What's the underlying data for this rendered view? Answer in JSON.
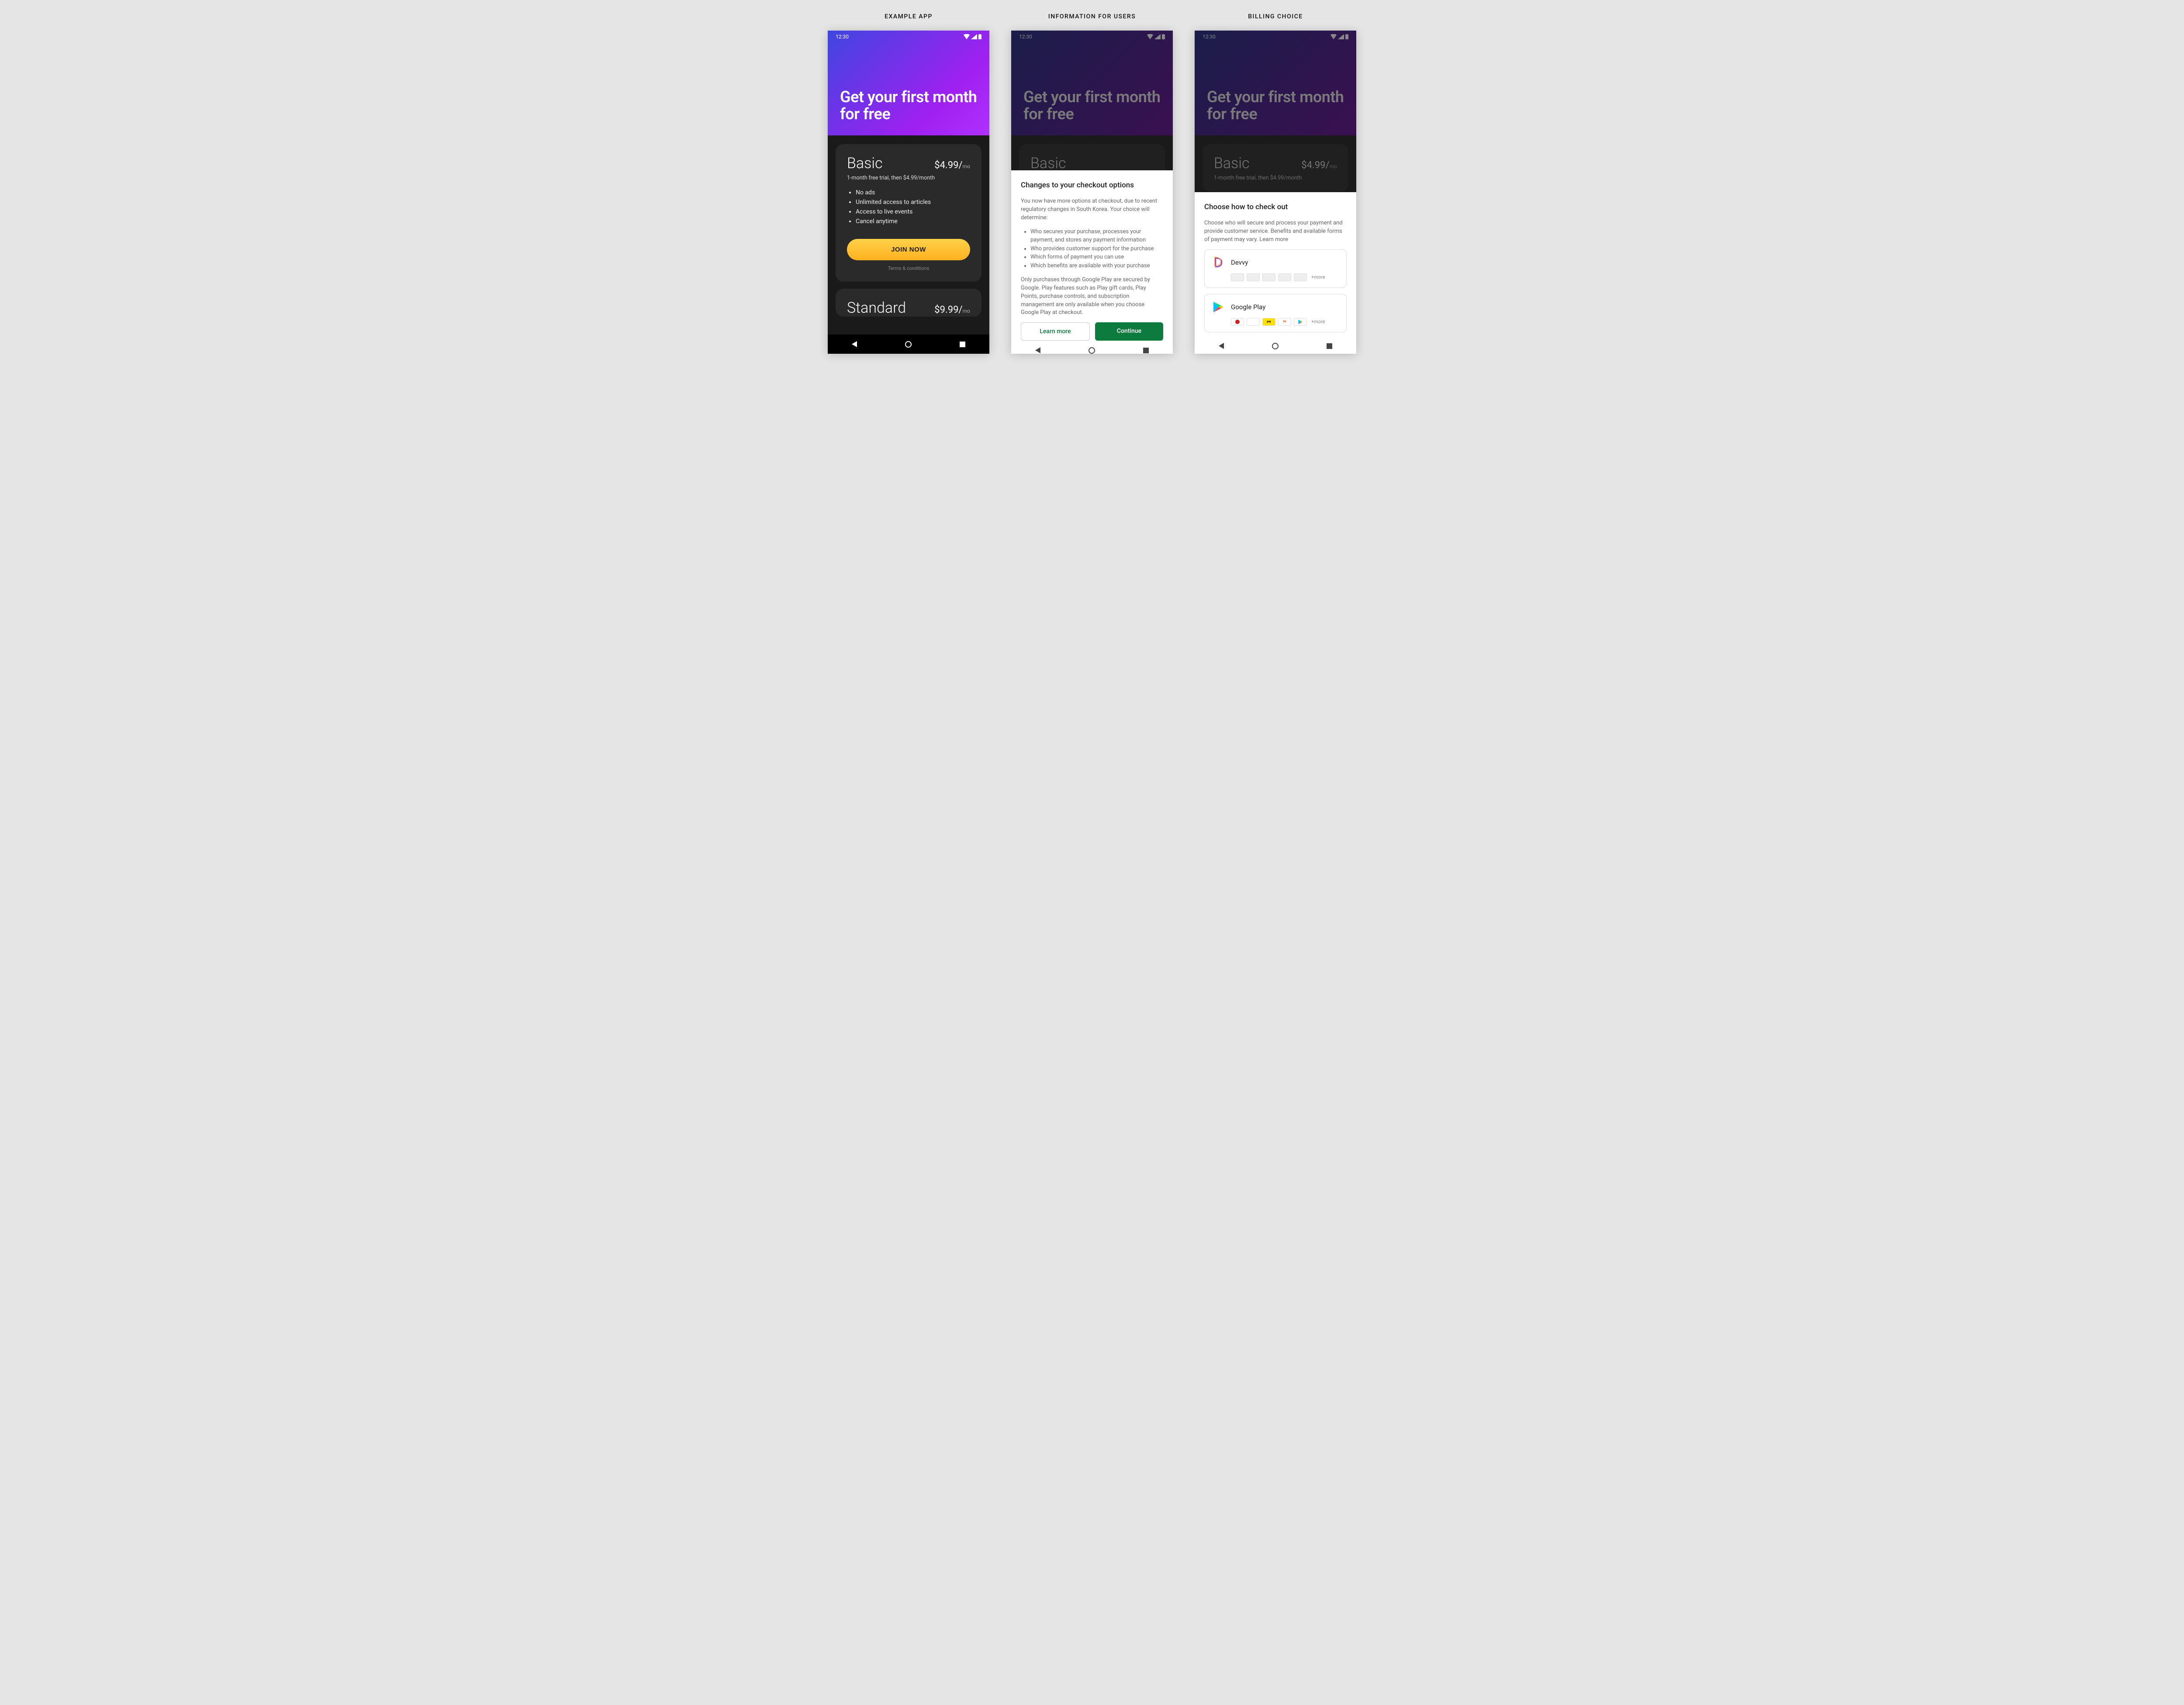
{
  "labels": {
    "col1": "EXAMPLE APP",
    "col2": "INFORMATION FOR USERS",
    "col3": "BILLING CHOICE"
  },
  "status": {
    "time": "12:30"
  },
  "hero": {
    "title": "Get your first month for free"
  },
  "plan_basic": {
    "name": "Basic",
    "price": "$4.99/",
    "per": "mo",
    "subtitle": "1-month free trial, then $4.99/month",
    "features": [
      "No ads",
      "Unlimited access to articles",
      "Access to live events",
      "Cancel anytime"
    ],
    "cta": "JOIN NOW",
    "terms": "Terms & conditions"
  },
  "plan_standard": {
    "name": "Standard",
    "price": "$9.99/",
    "per": "mo"
  },
  "info_sheet": {
    "title": "Changes to your checkout options",
    "intro": "You now have more options at checkout, due to recent regulatory changes in South Korea. Your choice will determine:",
    "bullets": [
      "Who secures your purchase, processes your payment, and stores any payment information",
      "Who provides customer support for the purchase",
      "Which forms of payment you can use",
      "Which benefits are available with your purchase"
    ],
    "footnote": "Only purchases through Google Play are secured by Google. Play features such as Play gift cards, Play Points, purchase controls, and subscription management are only available when you choose Google Play at checkout.",
    "learn_more": "Learn more",
    "continue": "Continue"
  },
  "choice_sheet": {
    "title": "Choose how to check out",
    "intro": "Choose who will secure and process your payment and provide customer service. Benefits and available forms of payment may vary. Learn more",
    "option1": {
      "name": "Devvy",
      "more": "+more"
    },
    "option2": {
      "name": "Google Play",
      "more": "+more"
    }
  }
}
